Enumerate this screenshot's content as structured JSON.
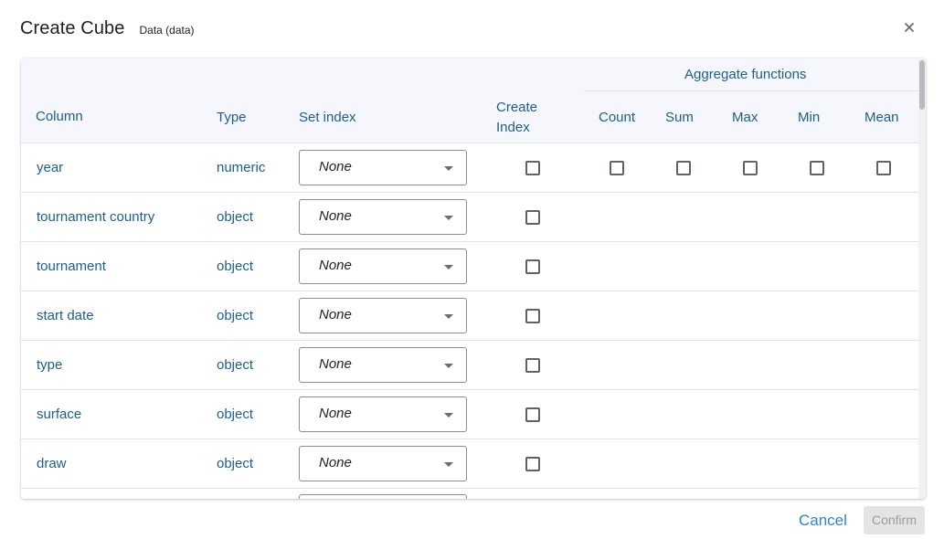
{
  "dialog": {
    "title": "Create Cube",
    "subtitle": "Data (data)",
    "close_icon": "close-icon"
  },
  "table": {
    "headers": {
      "column": "Column",
      "type": "Type",
      "set_index": "Set index",
      "create_index_line1": "Create",
      "create_index_line2": "Index",
      "aggregate_functions": "Aggregate functions",
      "count": "Count",
      "sum": "Sum",
      "max": "Max",
      "min": "Min",
      "mean": "Mean"
    },
    "rows": [
      {
        "name": "year",
        "type": "numeric",
        "set_index": "None",
        "create_index": false,
        "aggregates": true
      },
      {
        "name": "tournament country",
        "type": "object",
        "set_index": "None",
        "create_index": false,
        "aggregates": false
      },
      {
        "name": "tournament",
        "type": "object",
        "set_index": "None",
        "create_index": false,
        "aggregates": false
      },
      {
        "name": "start date",
        "type": "object",
        "set_index": "None",
        "create_index": false,
        "aggregates": false
      },
      {
        "name": "type",
        "type": "object",
        "set_index": "None",
        "create_index": false,
        "aggregates": false
      },
      {
        "name": "surface",
        "type": "object",
        "set_index": "None",
        "create_index": false,
        "aggregates": false
      },
      {
        "name": "draw",
        "type": "object",
        "set_index": "None",
        "create_index": false,
        "aggregates": false
      }
    ]
  },
  "footer": {
    "cancel_label": "Cancel",
    "confirm_label": "Confirm",
    "confirm_disabled": true
  },
  "colors": {
    "link_text": "#1c5e8e",
    "header_bg": "#f5f7fd",
    "cancel_text": "#2c84c9",
    "confirm_bg_disabled": "#e4e4e4"
  }
}
